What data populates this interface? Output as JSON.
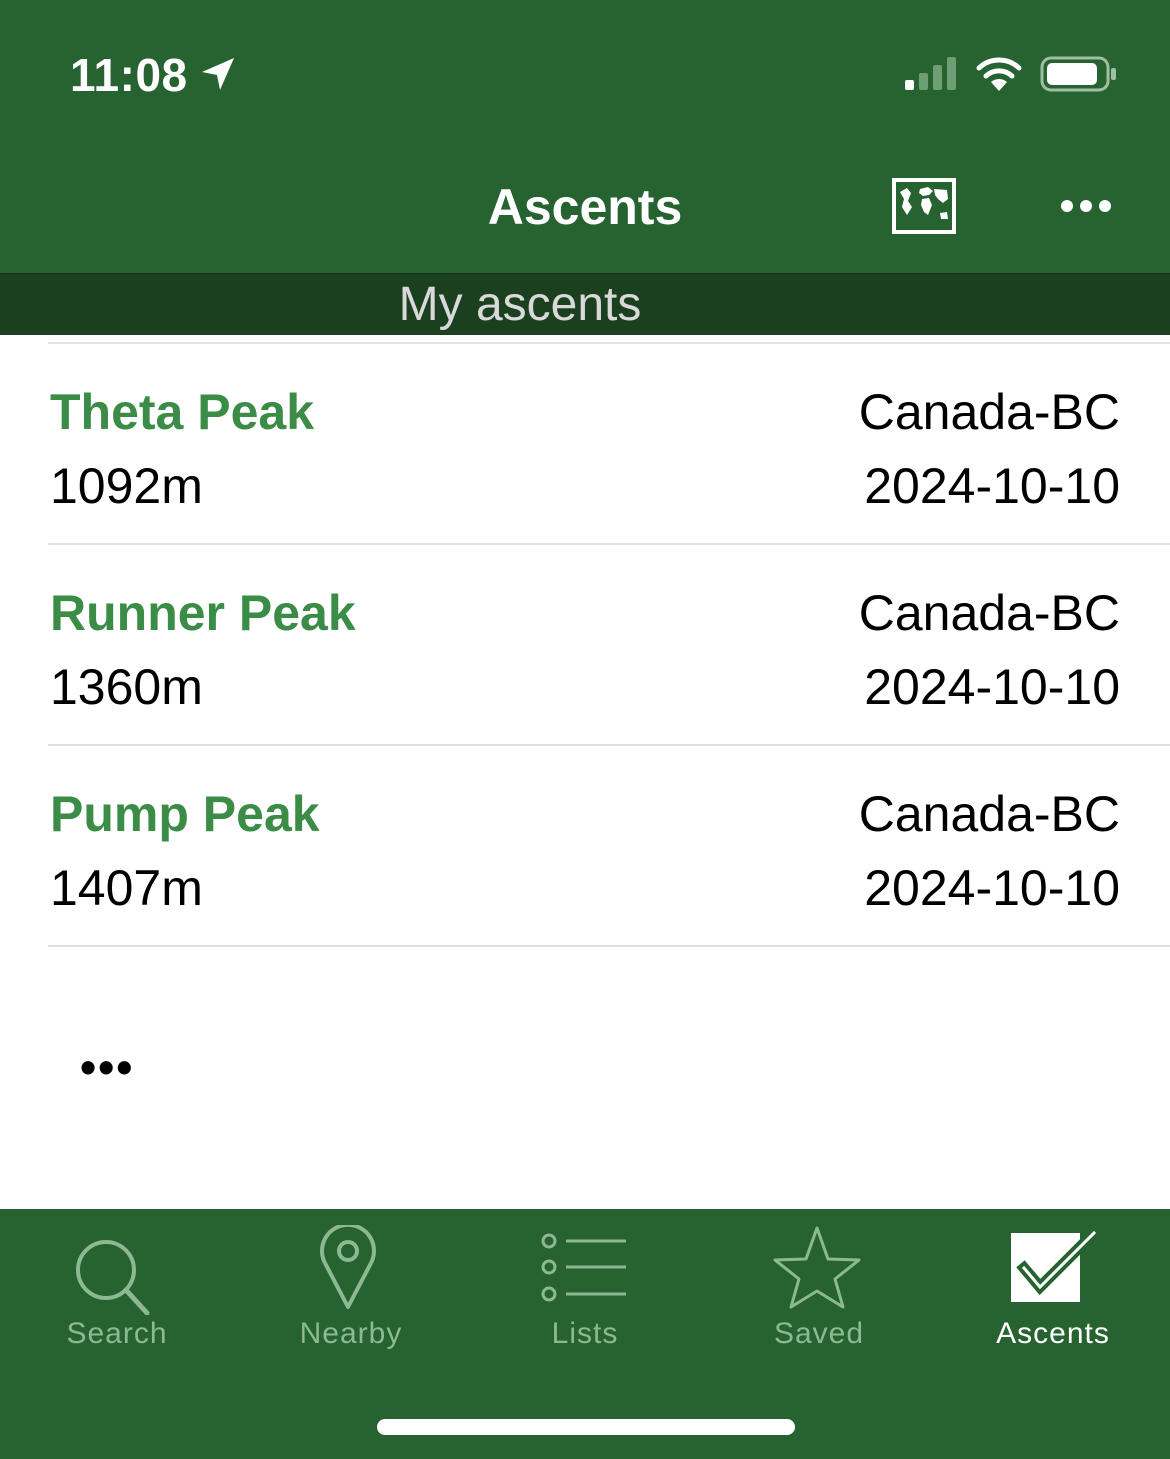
{
  "status_bar": {
    "time": "11:08"
  },
  "nav": {
    "title": "Ascents"
  },
  "section": {
    "title": "My ascents"
  },
  "ascents": [
    {
      "name": "Theta Peak",
      "elevation": "1092m",
      "region": "Canada-BC",
      "date": "2024-10-10"
    },
    {
      "name": "Runner Peak",
      "elevation": "1360m",
      "region": "Canada-BC",
      "date": "2024-10-10"
    },
    {
      "name": "Pump Peak",
      "elevation": "1407m",
      "region": "Canada-BC",
      "date": "2024-10-10"
    }
  ],
  "more_rows_label": "•••",
  "tabs": [
    {
      "label": "Search",
      "icon": "search-icon"
    },
    {
      "label": "Nearby",
      "icon": "location-pin-icon"
    },
    {
      "label": "Lists",
      "icon": "list-icon"
    },
    {
      "label": "Saved",
      "icon": "star-icon"
    },
    {
      "label": "Ascents",
      "icon": "checkbox-icon",
      "active": true
    }
  ],
  "colors": {
    "header_green": "#266331",
    "section_bar": "#1b401f",
    "peak_name_green": "#3a8c46",
    "tab_inactive": "#8db893"
  }
}
